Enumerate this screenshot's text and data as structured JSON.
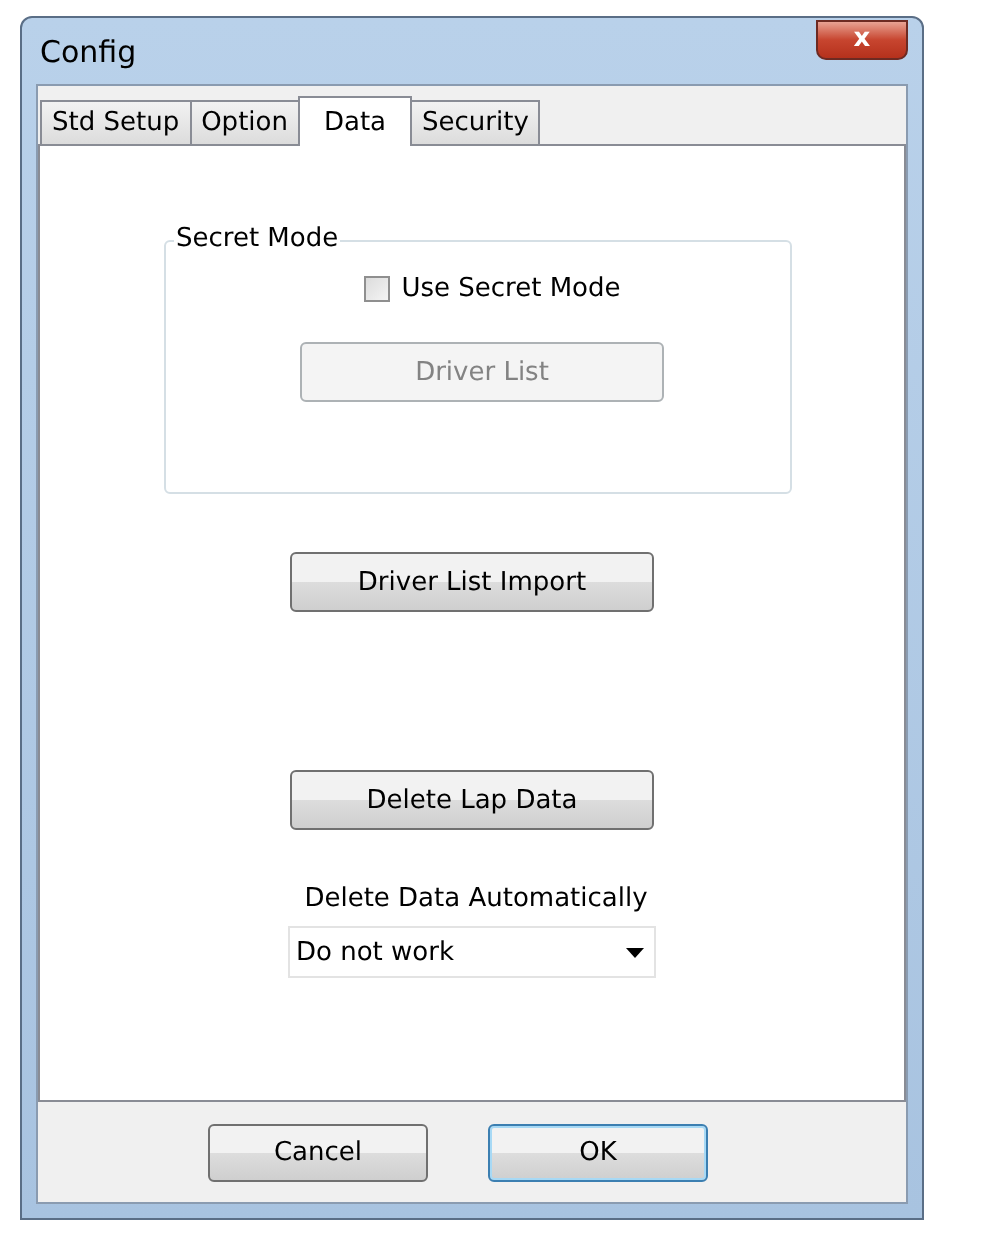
{
  "window": {
    "title": "Config",
    "close": "x"
  },
  "tabs": [
    {
      "label": "Std Setup",
      "selected": false
    },
    {
      "label": "Option",
      "selected": false
    },
    {
      "label": "Data",
      "selected": true
    },
    {
      "label": "Security",
      "selected": false
    }
  ],
  "secret_mode": {
    "title": "Secret Mode",
    "checkbox": {
      "label": "Use Secret Mode",
      "checked": false
    },
    "driver_list": {
      "label": "Driver List",
      "disabled": true
    }
  },
  "import_button": {
    "label": "Driver List Import",
    "disabled": false
  },
  "delete_button": {
    "label": "Delete Lap Data",
    "disabled": false
  },
  "auto_delete": {
    "label": "Delete Data Automatically",
    "value": "Do not work"
  },
  "buttons": [
    {
      "label": "Cancel",
      "default": false
    },
    {
      "label": "OK",
      "default": true
    }
  ]
}
